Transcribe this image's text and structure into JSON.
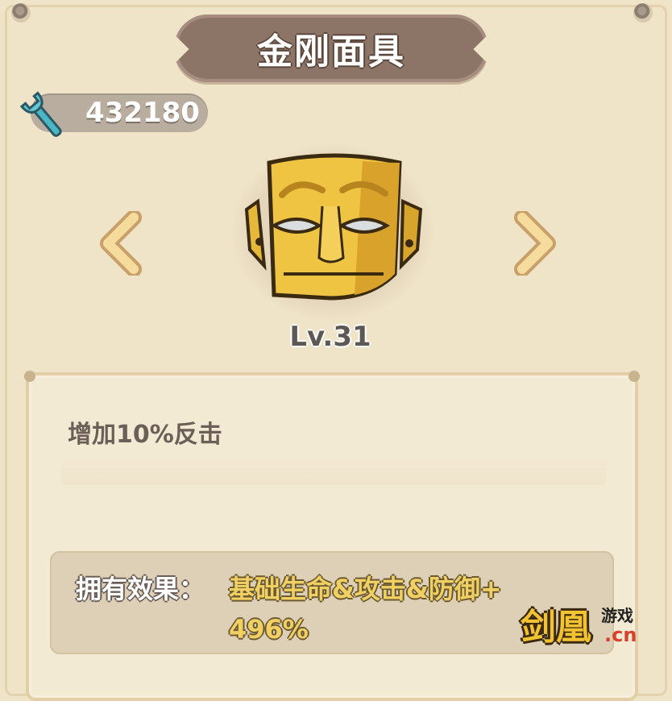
{
  "title": "金刚面具",
  "currency": {
    "icon": "wrench-icon",
    "value": "432180"
  },
  "item": {
    "icon": "golden-mask-icon",
    "level": "Lv.31"
  },
  "description": "增加10%反击",
  "effect": {
    "label": "拥有效果：",
    "value_line1": "基础生命&攻击&防御+",
    "value_line2": "496%"
  },
  "navigation": {
    "prev_icon": "chevron-left-icon",
    "next_icon": "chevron-right-icon"
  },
  "watermark": {
    "main": "剑凰",
    "sub": "游戏",
    "domain": ".cn"
  },
  "colors": {
    "background": "#efe3c8",
    "banner": "#8c7467",
    "effect_text": "#f0cf63",
    "desc_text": "#6b5f58"
  }
}
